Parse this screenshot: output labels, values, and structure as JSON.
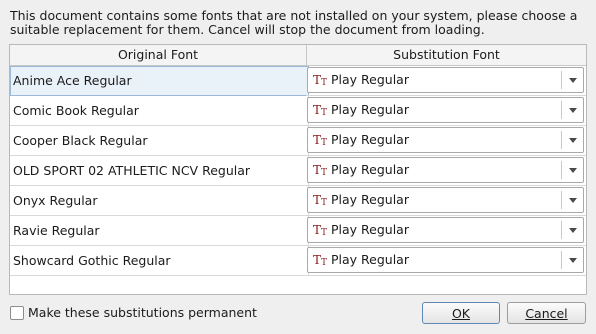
{
  "message": {
    "line1": "This document contains some fonts that are not installed on your system, please choose a",
    "line2": "suitable replacement for them. Cancel will stop the document from loading."
  },
  "table": {
    "headers": [
      "Original Font",
      "Substitution Font"
    ],
    "rows": [
      {
        "original": "Anime Ace Regular",
        "substitution": "Play Regular"
      },
      {
        "original": "Comic Book Regular",
        "substitution": "Play Regular"
      },
      {
        "original": "Cooper Black Regular",
        "substitution": "Play Regular"
      },
      {
        "original": "OLD SPORT 02 ATHLETIC NCV Regular",
        "substitution": "Play Regular"
      },
      {
        "original": "Onyx Regular",
        "substitution": "Play Regular"
      },
      {
        "original": "Ravie Regular",
        "substitution": "Play Regular"
      },
      {
        "original": "Showcard Gothic Regular",
        "substitution": "Play Regular"
      }
    ],
    "selected_row": 0
  },
  "icons": {
    "font_icon": "truetype-font-icon",
    "dropdown": "chevron-down-icon"
  },
  "options": {
    "permanent_label": "Make these substitutions permanent",
    "permanent_checked": false
  },
  "buttons": {
    "ok": "OK",
    "cancel": "Cancel"
  }
}
